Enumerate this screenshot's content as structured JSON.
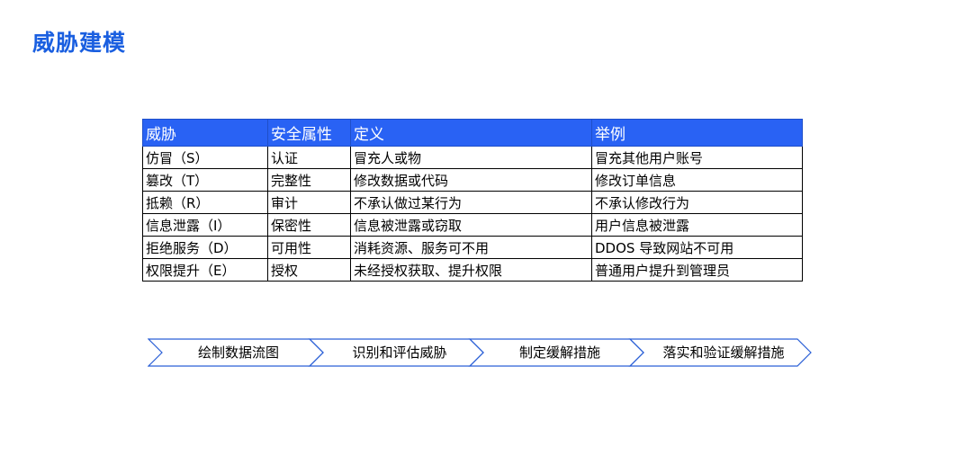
{
  "title": "威胁建模",
  "table": {
    "headers": [
      "威胁",
      "安全属性",
      "定义",
      "举例"
    ],
    "rows": [
      [
        "仿冒（S）",
        "认证",
        "冒充人或物",
        "冒充其他用户账号"
      ],
      [
        "篡改（T）",
        "完整性",
        "修改数据或代码",
        "修改订单信息"
      ],
      [
        "抵赖（R）",
        "审计",
        "不承认做过某行为",
        "不承认修改行为"
      ],
      [
        "信息泄露（I）",
        "保密性",
        "信息被泄露或窃取",
        "用户信息被泄露"
      ],
      [
        "拒绝服务（D）",
        "可用性",
        "消耗资源、服务可不用",
        "DDOS 导致网站不可用"
      ],
      [
        "权限提升（E）",
        "授权",
        "未经授权获取、提升权限",
        "普通用户提升到管理员"
      ]
    ]
  },
  "steps": [
    "绘制数据流图",
    "识别和评估威胁",
    "制定缓解措施",
    "落实和验证缓解措施"
  ],
  "colors": {
    "title": "#1a5fe0",
    "header_bg": "#2962f4",
    "arrow_stroke": "#2a5fd6"
  }
}
